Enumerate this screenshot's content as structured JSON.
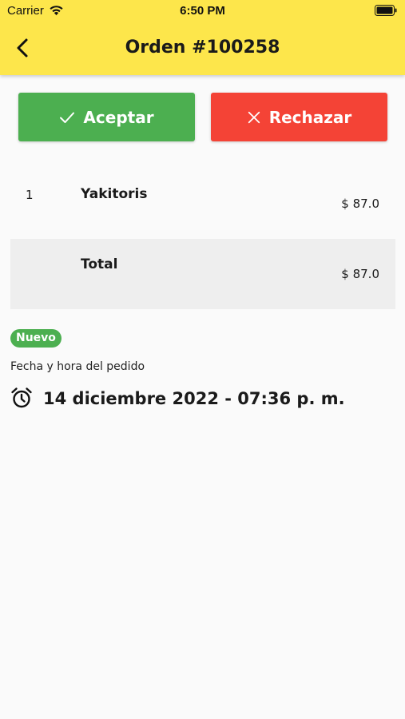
{
  "status_bar": {
    "carrier": "Carrier",
    "time": "6:50 PM",
    "icons": [
      "wifi-icon",
      "battery-icon"
    ]
  },
  "app_bar": {
    "back_icon": "chevron-left-icon",
    "title": "Orden #100258"
  },
  "actions": {
    "accept_label": "Aceptar",
    "accept_icon": "check-icon",
    "reject_label": "Rechazar",
    "reject_icon": "close-icon"
  },
  "order": {
    "items": [
      {
        "qty": "1",
        "name": "Yakitoris",
        "price": "$ 87.0"
      }
    ],
    "total_label": "Total",
    "total_price": "$ 87.0"
  },
  "status": {
    "badge": "Nuevo"
  },
  "order_time": {
    "label": "Fecha y hora del pedido",
    "icon": "alarm-clock-icon",
    "value": "14 diciembre 2022 - 07:36 p. m."
  },
  "colors": {
    "app_bar": "#fde64b",
    "accept": "#4caf50",
    "reject": "#f44336",
    "badge": "#4caf50",
    "background": "#fafafa",
    "total_row": "#eeeeee"
  }
}
